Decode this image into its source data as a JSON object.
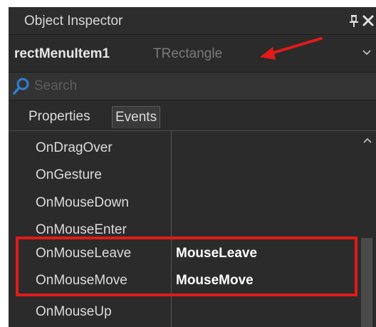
{
  "window": {
    "title": "Object Inspector"
  },
  "object_selector": {
    "name": "rectMenuItem1",
    "type": "TRectangle"
  },
  "search": {
    "placeholder": "Search",
    "value": ""
  },
  "tabs": [
    {
      "label": "Properties",
      "active": false
    },
    {
      "label": "Events",
      "active": true
    }
  ],
  "events": [
    {
      "name": "OnDragOver",
      "value": ""
    },
    {
      "name": "OnGesture",
      "value": ""
    },
    {
      "name": "OnMouseDown",
      "value": ""
    },
    {
      "name": "OnMouseEnter",
      "value": ""
    },
    {
      "name": "OnMouseLeave",
      "value": "MouseLeave"
    },
    {
      "name": "OnMouseMove",
      "value": "MouseMove"
    },
    {
      "name": "OnMouseUp",
      "value": ""
    }
  ],
  "icons": {
    "pin": "pin-icon",
    "close": "close-icon",
    "dropdown": "chevron-down-icon",
    "search": "search-icon",
    "scroll_up": "chevron-up-icon"
  },
  "colors": {
    "panel_bg": "#2b2b2b",
    "annotation_red": "#e31a1a",
    "search_icon_blue": "#2f7fd6",
    "type_text_gray": "#7a7a7a"
  }
}
